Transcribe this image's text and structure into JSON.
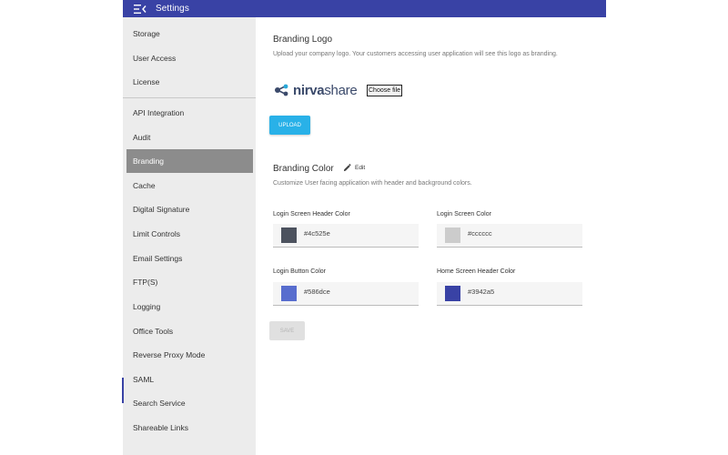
{
  "topbar": {
    "title": "Settings",
    "menu_icon": "menu-collapse-icon"
  },
  "sidebar": {
    "items": [
      {
        "label": "Storage"
      },
      {
        "label": "User Access"
      },
      {
        "label": "License"
      },
      {
        "label": "API Integration"
      },
      {
        "label": "Audit"
      },
      {
        "label": "Branding",
        "active": true
      },
      {
        "label": "Cache"
      },
      {
        "label": "Digital Signature"
      },
      {
        "label": "Limit Controls"
      },
      {
        "label": "Email Settings"
      },
      {
        "label": "FTP(S)"
      },
      {
        "label": "Logging"
      },
      {
        "label": "Office Tools"
      },
      {
        "label": "Reverse Proxy Mode"
      },
      {
        "label": "SAML"
      },
      {
        "label": "Search Service"
      },
      {
        "label": "Shareable Links"
      }
    ]
  },
  "branding_logo": {
    "title": "Branding Logo",
    "description": "Upload your company logo. Your customers accessing user application will see this logo as branding.",
    "logo_text_nirva": "nirva",
    "logo_text_share": "share",
    "choose_file_label": "Choose file",
    "upload_label": "UPLOAD"
  },
  "branding_color": {
    "title": "Branding Color",
    "edit_label": "Edit",
    "description": "Customize User facing application with header and background colors.",
    "fields": [
      {
        "label": "Login Screen Header Color",
        "value": "#4c525e",
        "color": "#4c525e"
      },
      {
        "label": "Login Screen Color",
        "value": "#cccccc",
        "color": "#cccccc"
      },
      {
        "label": "Login Button Color",
        "value": "#586dce",
        "color": "#586dce"
      },
      {
        "label": "Home Screen Header Color",
        "value": "#3942a5",
        "color": "#3942a5"
      }
    ],
    "save_label": "SAVE"
  },
  "colors": {
    "header": "#3942a5",
    "sidebar_bg": "#ececec",
    "active_item": "#8c8c8c",
    "upload_button": "#29b1e8"
  }
}
